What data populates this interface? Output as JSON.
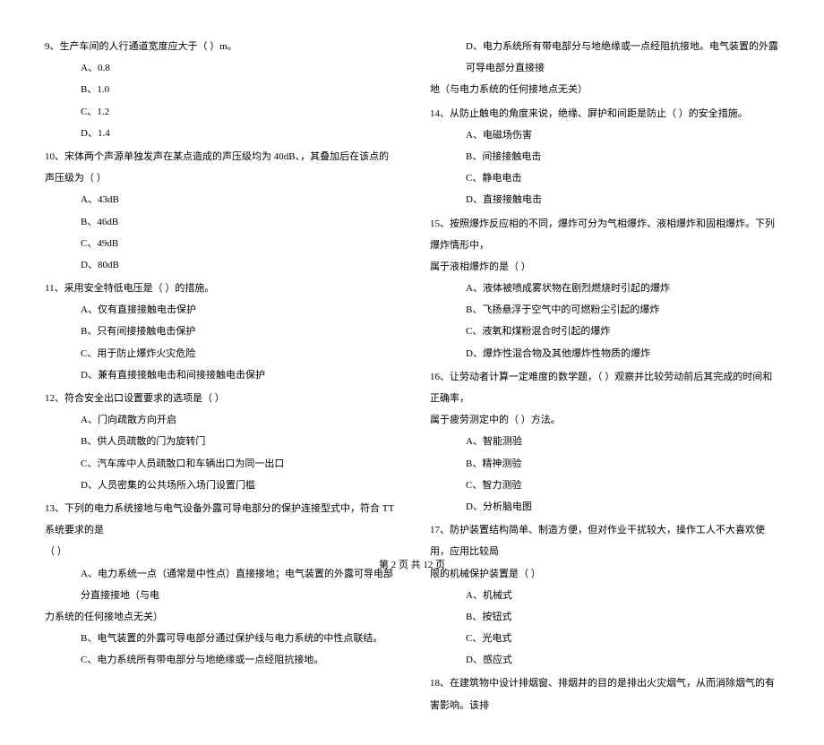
{
  "left": {
    "q9": {
      "text": "9、生产车间的人行通道宽度应大于（    ）m。",
      "A": "A、0.8",
      "B": "B、1.0",
      "C": "C、1.2",
      "D": "D、1.4"
    },
    "q10": {
      "text": "10、宋体两个声源单独发声在某点造成的声压级均为 40dB、，其叠加后在该点的声压级为（    ）",
      "A": "A、43dB",
      "B": "B、46dB",
      "C": "C、49dB",
      "D": "D、80dB"
    },
    "q11": {
      "text": "11、采用安全特低电压是（    ）的措施。",
      "A": "A、仅有直接接触电击保护",
      "B": "B、只有间接接触电击保护",
      "C": "C、用于防止爆炸火灾危险",
      "D": "D、兼有直接接触电击和间接接触电击保护"
    },
    "q12": {
      "text": "12、符合安全出口设置要求的选项是（    ）",
      "A": "A、门向疏散方向开启",
      "B": "B、供人员疏散的门为旋转门",
      "C": "C、汽车库中人员疏散口和车辆出口为同一出口",
      "D": "D、人员密集的公共场所入场门设置门槛"
    },
    "q13": {
      "text": "13、下列的电力系统接地与电气设备外露可导电部分的保护连接型式中，符合 TT 系统要求的是",
      "cont": "（    ）",
      "A": "A、电力系统一点（通常是中性点）直接接地；电气装置的外露可导电部分直接接地（与电",
      "A2": "力系统的任何接地点无关）",
      "B": "B、电气装置的外露可导电部分通过保护线与电力系统的中性点联结。",
      "C": "C、电力系统所有带电部分与地绝缘或一点经阻抗接地。"
    }
  },
  "right": {
    "q13D": {
      "D": "D、电力系统所有带电部分与地绝缘或一点经阻抗接地。电气装置的外露可导电部分直接接",
      "D2": "地（与电力系统的任何接地点无关）"
    },
    "q14": {
      "text": "14、从防止触电的角度来说，绝缘、屏护和间距是防止（    ）的安全措施。",
      "A": "A、电磁场伤害",
      "B": "B、间接接触电击",
      "C": "C、静电电击",
      "D": "D、直接接触电击"
    },
    "q15": {
      "text": "15、按照爆炸反应相的不同，爆炸可分为气相爆炸、液相爆炸和固相爆炸。下列爆炸情形中，",
      "cont": "属于液相爆炸的是（    ）",
      "A": "A、液体被喷成雾状物在剧烈燃烧时引起的爆炸",
      "B": "B、飞扬悬浮于空气中的可燃粉尘引起的爆炸",
      "C": "C、液氧和煤粉混合时引起的爆炸",
      "D": "D、爆炸性混合物及其他爆炸性物质的爆炸"
    },
    "q16": {
      "text": "16、让劳动者计算一定难度的数学题，（    ）观察并比较劳动前后其完成的时间和正确率，",
      "cont": "属于疲劳测定中的（    ）方法。",
      "A": "A、智能测验",
      "B": "B、精神测验",
      "C": "C、智力测验",
      "D": "D、分析脑电图"
    },
    "q17": {
      "text": "17、防护装置结构简单、制造方便，但对作业干扰较大，操作工人不大喜欢使用，应用比较局",
      "cont": "限的机械保护装置是（    ）",
      "A": "A、机械式",
      "B": "B、按钮式",
      "C": "C、光电式",
      "D": "D、感应式"
    },
    "q18": {
      "text": "18、在建筑物中设计排烟窗、排烟井的目的是排出火灾烟气，从而消除烟气的有害影响。该排"
    }
  },
  "footer": "第 2 页 共 12 页"
}
